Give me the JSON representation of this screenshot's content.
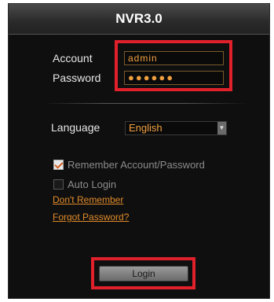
{
  "title": "NVR3.0",
  "account": {
    "label": "Account",
    "value": "admin"
  },
  "password": {
    "label": "Password",
    "masked_value": "●●●●●●"
  },
  "language": {
    "label": "Language",
    "selected": "English"
  },
  "options": {
    "remember_label": "Remember Account/Password",
    "remember_checked": true,
    "auto_login_label": "Auto Login",
    "auto_login_checked": false
  },
  "links": {
    "dont_remember": "Don't Remember",
    "forgot_password": "Forgot Password?"
  },
  "login_button": "Login",
  "colors": {
    "highlight": "#e0202a",
    "accent": "#f0a040",
    "background": "#0f0f0f"
  },
  "icons": {
    "dropdown": "chevron-down-icon",
    "check": "checkmark-icon"
  }
}
